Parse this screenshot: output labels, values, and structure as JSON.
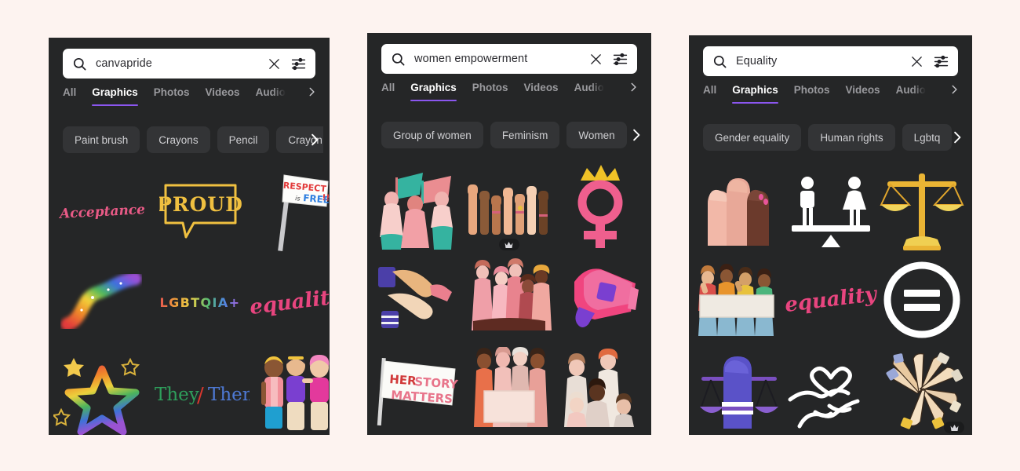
{
  "background_color": "#fdf3f0",
  "panel_color": "#252627",
  "accent_color": "#8b56ef",
  "panels": [
    {
      "id": "panel-1",
      "search": {
        "value": "canvapride",
        "placeholder": "Search",
        "search_icon": "search-icon",
        "clear_icon": "close-icon",
        "filter_icon": "filter-sliders-icon"
      },
      "tabs": [
        {
          "label": "All",
          "active": false
        },
        {
          "label": "Graphics",
          "active": true
        },
        {
          "label": "Photos",
          "active": false
        },
        {
          "label": "Videos",
          "active": false
        },
        {
          "label": "Audio",
          "active": false
        }
      ],
      "tabs_next_icon": "chevron-right-icon",
      "chips": [
        "Paint brush",
        "Crayons",
        "Pencil",
        "Crayon"
      ],
      "chips_next_icon": "chevron-right-icon",
      "results": [
        {
          "name": "acceptance-lettering",
          "label": "Acceptance",
          "pro": false
        },
        {
          "name": "proud-speech-bubble",
          "label": "PROUD",
          "pro": false
        },
        {
          "name": "respect-is-free-flag",
          "label": "RESPECT is FREE!!",
          "pro": false
        },
        {
          "name": "rainbow-swoosh",
          "label": "Rainbow swoosh",
          "pro": false
        },
        {
          "name": "lgbtqia-plus-lettering",
          "label": "LGBTQIA+",
          "pro": false
        },
        {
          "name": "equality-lettering",
          "label": "equality",
          "pro": false
        },
        {
          "name": "rainbow-star-outline",
          "label": "Rainbow star",
          "pro": false
        },
        {
          "name": "they-them-lettering",
          "label": "They / Them",
          "pro": false
        },
        {
          "name": "three-friends-illustration",
          "label": "Three friends",
          "pro": false
        }
      ]
    },
    {
      "id": "panel-2",
      "search": {
        "value": "women empowerment",
        "placeholder": "Search",
        "search_icon": "search-icon",
        "clear_icon": "close-icon",
        "filter_icon": "filter-sliders-icon"
      },
      "tabs": [
        {
          "label": "All",
          "active": false
        },
        {
          "label": "Graphics",
          "active": true
        },
        {
          "label": "Photos",
          "active": false
        },
        {
          "label": "Videos",
          "active": false
        },
        {
          "label": "Audio",
          "active": false
        }
      ],
      "tabs_next_icon": "chevron-right-icon",
      "chips": [
        "Group of women",
        "Feminism",
        "Women"
      ],
      "chips_next_icon": "chevron-right-icon",
      "results": [
        {
          "name": "women-with-flags",
          "label": "Women with flags",
          "pro": false
        },
        {
          "name": "raised-fists-row",
          "label": "Raised fists",
          "pro": true
        },
        {
          "name": "venus-symbol-crown",
          "label": "Venus symbol with crown",
          "pro": false
        },
        {
          "name": "stacked-hands",
          "label": "Stacked hands",
          "pro": false
        },
        {
          "name": "group-of-women-pink",
          "label": "Group of women",
          "pro": false
        },
        {
          "name": "pink-megaphone",
          "label": "Megaphone",
          "pro": false
        },
        {
          "name": "herstory-matters-flag",
          "label": "HER STORY MATTERS",
          "pro": false
        },
        {
          "name": "women-holding-banner",
          "label": "Women holding banner",
          "pro": false
        },
        {
          "name": "women-family-group",
          "label": "Women group",
          "pro": false
        }
      ]
    },
    {
      "id": "panel-3",
      "search": {
        "value": "Equality",
        "placeholder": "Search",
        "search_icon": "search-icon",
        "clear_icon": "close-icon",
        "filter_icon": "filter-sliders-icon"
      },
      "tabs": [
        {
          "label": "All",
          "active": false
        },
        {
          "label": "Graphics",
          "active": true
        },
        {
          "label": "Photos",
          "active": false
        },
        {
          "label": "Videos",
          "active": false
        },
        {
          "label": "Audio",
          "active": false
        }
      ],
      "tabs_next_icon": "chevron-right-icon",
      "chips": [
        "Gender equality",
        "Human rights",
        "Lgbtq"
      ],
      "chips_next_icon": "chevron-right-icon",
      "results": [
        {
          "name": "three-raised-fists",
          "label": "Three raised fists",
          "pro": false
        },
        {
          "name": "gender-balance-seesaw",
          "label": "Gender balance",
          "pro": false
        },
        {
          "name": "gold-justice-scales",
          "label": "Scales of justice",
          "pro": false
        },
        {
          "name": "protesters-with-banner",
          "label": "Protesters with banner",
          "pro": false
        },
        {
          "name": "equality-lettering",
          "label": "equality",
          "pro": false
        },
        {
          "name": "equals-sign-circle",
          "label": "Equals sign",
          "pro": false
        },
        {
          "name": "fist-over-scales",
          "label": "Fist over scales",
          "pro": false
        },
        {
          "name": "handshake-heart-outline",
          "label": "Handshake with heart",
          "pro": false
        },
        {
          "name": "hands-circle-unity",
          "label": "Hands in circle",
          "pro": true
        }
      ]
    }
  ]
}
